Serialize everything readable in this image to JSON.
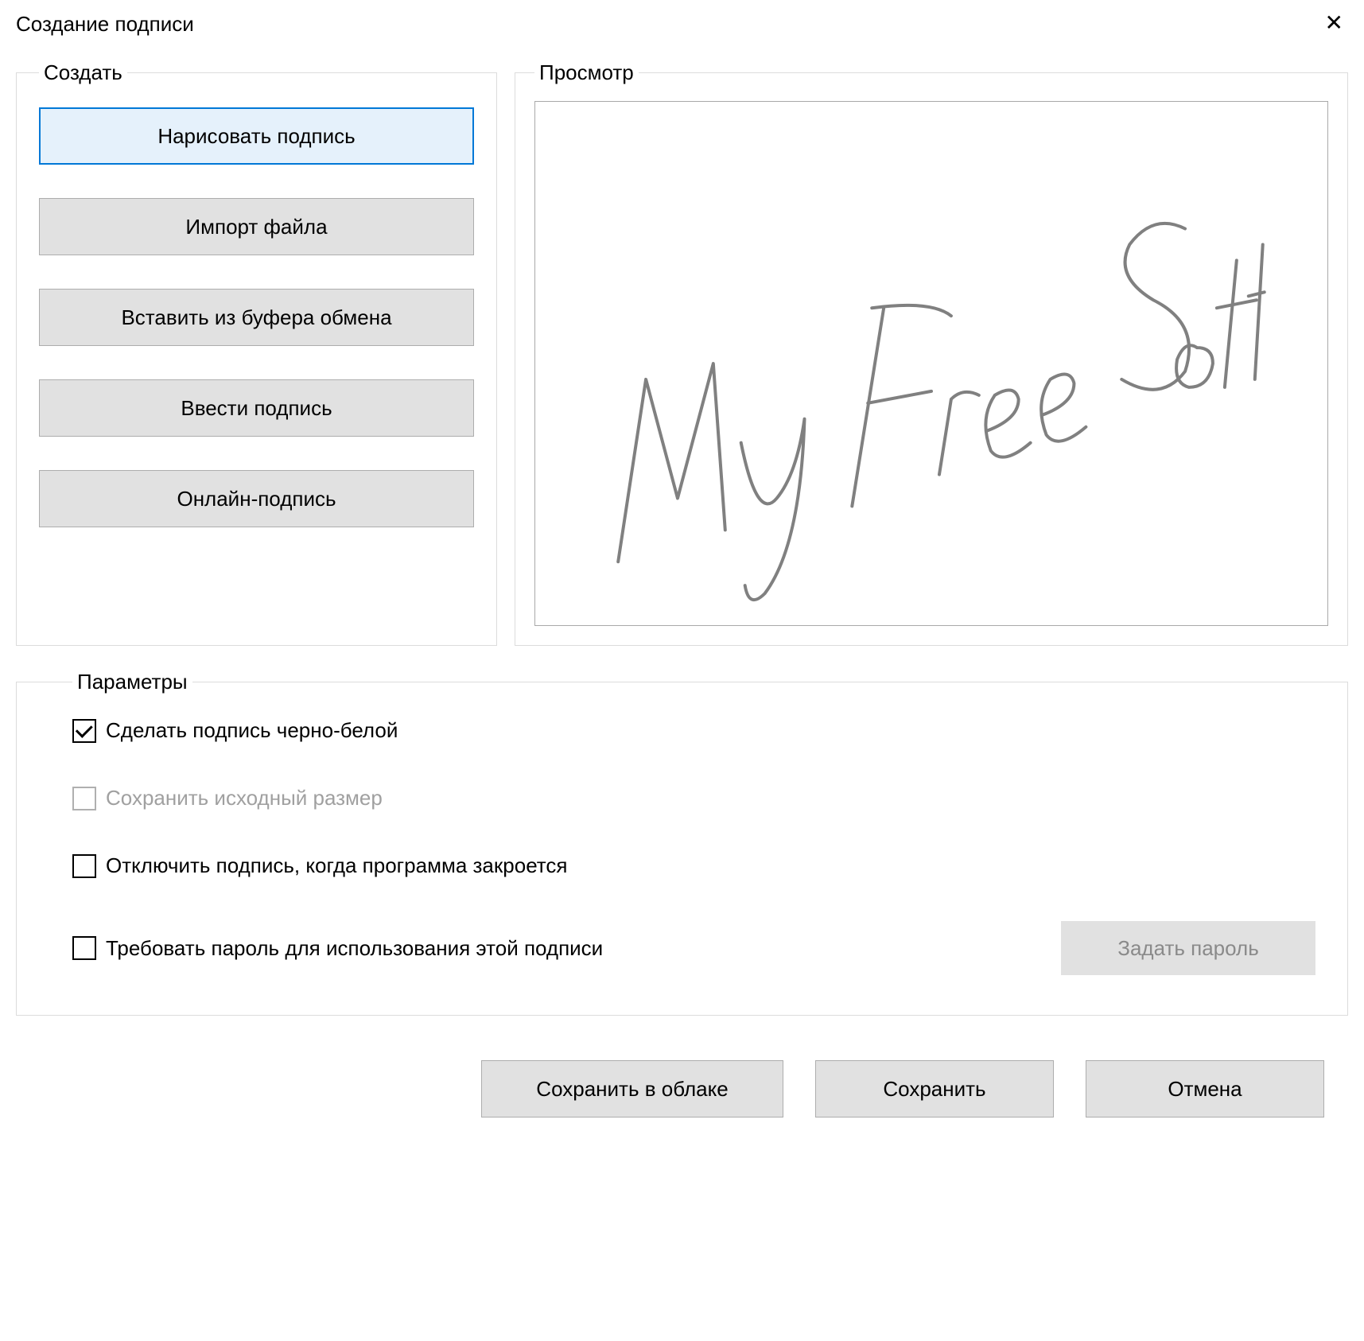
{
  "title": "Создание подписи",
  "create_group": {
    "legend": "Создать",
    "draw": "Нарисовать подпись",
    "import": "Импорт файла",
    "paste": "Вставить из буфера обмена",
    "type": "Ввести подпись",
    "online": "Онлайн-подпись"
  },
  "preview_group": {
    "legend": "Просмотр",
    "signature_text": "My Free Soft"
  },
  "params_group": {
    "legend": "Параметры",
    "bw": "Сделать подпись черно-белой",
    "keep_size": "Сохранить исходный размер",
    "discard": "Отключить подпись, когда программа закроется",
    "require_pw": "Требовать пароль для использования этой подписи",
    "set_pw": "Задать пароль"
  },
  "footer": {
    "save_cloud": "Сохранить в облаке",
    "save": "Сохранить",
    "cancel": "Отмена"
  }
}
